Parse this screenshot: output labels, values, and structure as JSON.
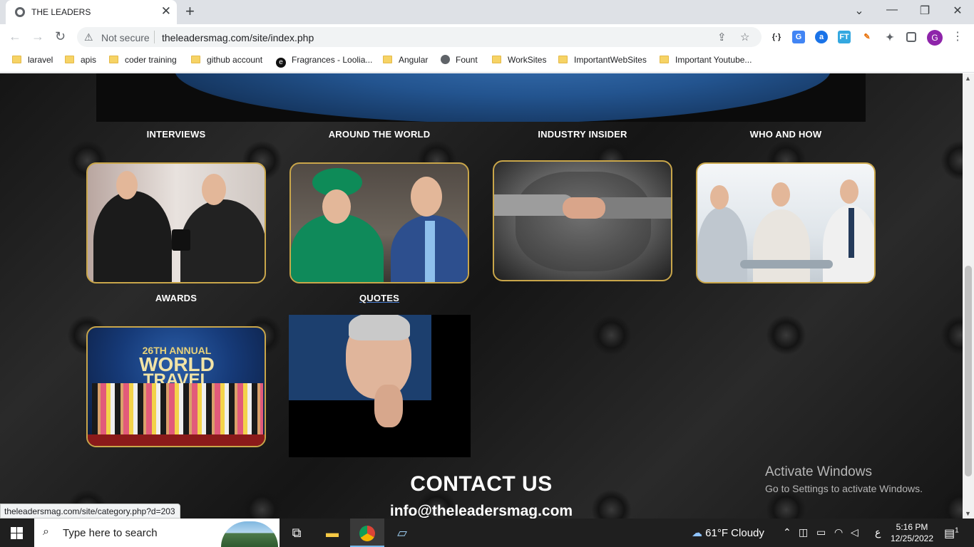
{
  "browser": {
    "tab_title": "THE LEADERS",
    "tab_close": "✕",
    "new_tab": "+",
    "window_controls": {
      "dropdown": "⌄",
      "minimize": "—",
      "maximize": "❐",
      "close": "✕"
    },
    "nav": {
      "back": "←",
      "forward": "→",
      "reload": "↻"
    },
    "security_label": "Not secure",
    "url": "theleadersmag.com/site/index.php",
    "extensions": [
      "{·}",
      "G",
      "a",
      "FT",
      "✎",
      "✦"
    ],
    "profile_initial": "G",
    "bookmarks": [
      {
        "label": "laravel",
        "icon": "folder-icon"
      },
      {
        "label": "apis",
        "icon": "folder-icon"
      },
      {
        "label": "coder training",
        "icon": "folder-icon"
      },
      {
        "label": "github account",
        "icon": "folder-icon"
      },
      {
        "label": "Fragrances - Loolia...",
        "icon": "site-icon"
      },
      {
        "label": "Angular",
        "icon": "folder-icon"
      },
      {
        "label": "Fount",
        "icon": "globe-icon"
      },
      {
        "label": "WorkSites",
        "icon": "folder-icon"
      },
      {
        "label": "ImportantWebSites",
        "icon": "folder-icon"
      },
      {
        "label": "Important Youtube...",
        "icon": "folder-icon"
      }
    ]
  },
  "page": {
    "categories": [
      {
        "label": "INTERVIEWS"
      },
      {
        "label": "AROUND THE WORLD"
      },
      {
        "label": "INDUSTRY INSIDER"
      },
      {
        "label": "WHO AND HOW"
      },
      {
        "label": "AWARDS"
      },
      {
        "label": "QUOTES"
      }
    ],
    "awards_card_text": {
      "line1": "26TH ANNUAL",
      "line2": "WORLD",
      "line3": "TRAVEL"
    },
    "contact_heading": "CONTACT US",
    "contact_email": "info@theleadersmag.com",
    "hover_link": "theleadersmag.com/site/category.php?d=203",
    "card_border_color": "#c9a64a"
  },
  "watermark": {
    "line1": "Activate Windows",
    "line2": "Go to Settings to activate Windows."
  },
  "taskbar": {
    "search_placeholder": "Type here to search",
    "weather": "61°F  Cloudy",
    "time": "5:16 PM",
    "date": "12/25/2022",
    "notification_count": "1",
    "lang": "ع"
  }
}
